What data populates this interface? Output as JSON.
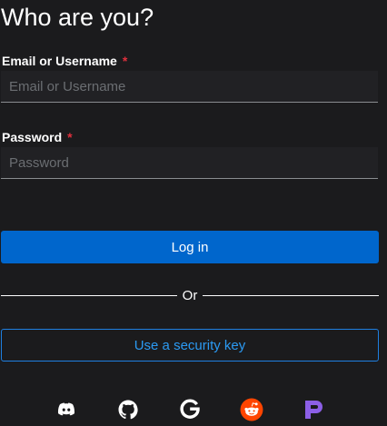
{
  "header": {
    "title": "Who are you?"
  },
  "form": {
    "username": {
      "label": "Email or Username",
      "required_mark": "*",
      "placeholder": "Email or Username",
      "value": ""
    },
    "password": {
      "label": "Password",
      "required_mark": "*",
      "placeholder": "Password",
      "value": ""
    },
    "login_label": "Log in",
    "divider_text": "Or",
    "security_key_label": "Use a security key"
  },
  "social_providers": [
    {
      "icon": "discord-icon",
      "color": "#ffffff"
    },
    {
      "icon": "github-icon",
      "color": "#ffffff"
    },
    {
      "icon": "google-icon",
      "color": "#ffffff"
    },
    {
      "icon": "reddit-icon",
      "color": "#ff4500"
    },
    {
      "icon": "patreon-icon",
      "color": "#8c5fe6"
    }
  ],
  "colors": {
    "background": "#1b1b1d",
    "primary": "#0066cc",
    "link": "#2b9af3",
    "required": "#e0303d"
  }
}
